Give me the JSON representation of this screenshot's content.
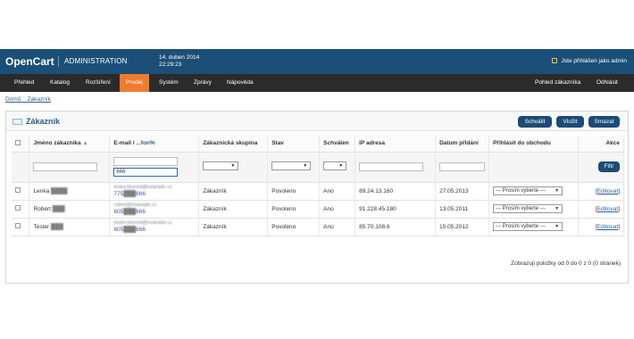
{
  "header": {
    "brand": "OpenCart",
    "admin": "ADMINISTRATION",
    "date_line1": "14. duben 2014",
    "date_line2": "22:29:23",
    "login_text": "Jste přihlášen jako admin"
  },
  "menu": {
    "items": [
      "Přehled",
      "Katalog",
      "Rozšíření",
      "Prodej",
      "Systém",
      "Zprávy",
      "Nápověda"
    ],
    "right_items": [
      "Pohled zákazníka",
      "Odhlásit"
    ]
  },
  "breadcrumb": {
    "home": "Domů",
    "separator": " :: ",
    "current": "Zákazník"
  },
  "panel": {
    "title": "Zákazník",
    "buttons": [
      "Schválit",
      "Vložit",
      "Smazat"
    ]
  },
  "table": {
    "headers": {
      "name": "Jméno zákazníka",
      "sort_arrow": "▲",
      "email_prefix": "E-mail / ",
      "email_link": "...fon%",
      "group": "Zákaznická skupina",
      "status": "Stav",
      "approved": "Schválen",
      "ip": "IP adresa",
      "date": "Datum přidání",
      "login": "Přihlásit do obchodu",
      "action": "Akce"
    },
    "filter": {
      "email_value": "666",
      "button": "Filtr"
    },
    "rows": [
      {
        "first_name": "Lenka",
        "email": "lenka.blurred@example.cz",
        "phone_start": "775",
        "phone_end": "666",
        "group": "Zákazník",
        "status": "Povoleno",
        "approved": "Ano",
        "ip": "89.24.13.160",
        "date": "27.05.2013",
        "store_select": "--- Prosím vyberte ---",
        "edit": "Editovat"
      },
      {
        "first_name": "Robert",
        "email": "robert@example.cz",
        "phone_start": "605",
        "phone_end": "666",
        "group": "Zákazník",
        "status": "Povoleno",
        "approved": "Ano",
        "ip": "91.228.45.180",
        "date": "13.05.2011",
        "store_select": "--- Prosím vyberte ---",
        "edit": "Editovat"
      },
      {
        "first_name": "Tester",
        "email": "tester.blurred@example.cz",
        "phone_start": "605",
        "phone_end": "666",
        "group": "Zákazník",
        "status": "Povoleno",
        "approved": "Ano",
        "ip": "85.70.108.6",
        "date": "15.05.2012",
        "store_select": "--- Prosím vyberte ---",
        "edit": "Editovat"
      }
    ],
    "pagination": "Zobrazuji položky od 0 do 0 z 0 (0 stránek)"
  },
  "colors": {
    "header": "#1b4f77",
    "menu": "#2b2b2b",
    "active_menu": "#ef7c2e",
    "button": "#1c4c76"
  }
}
